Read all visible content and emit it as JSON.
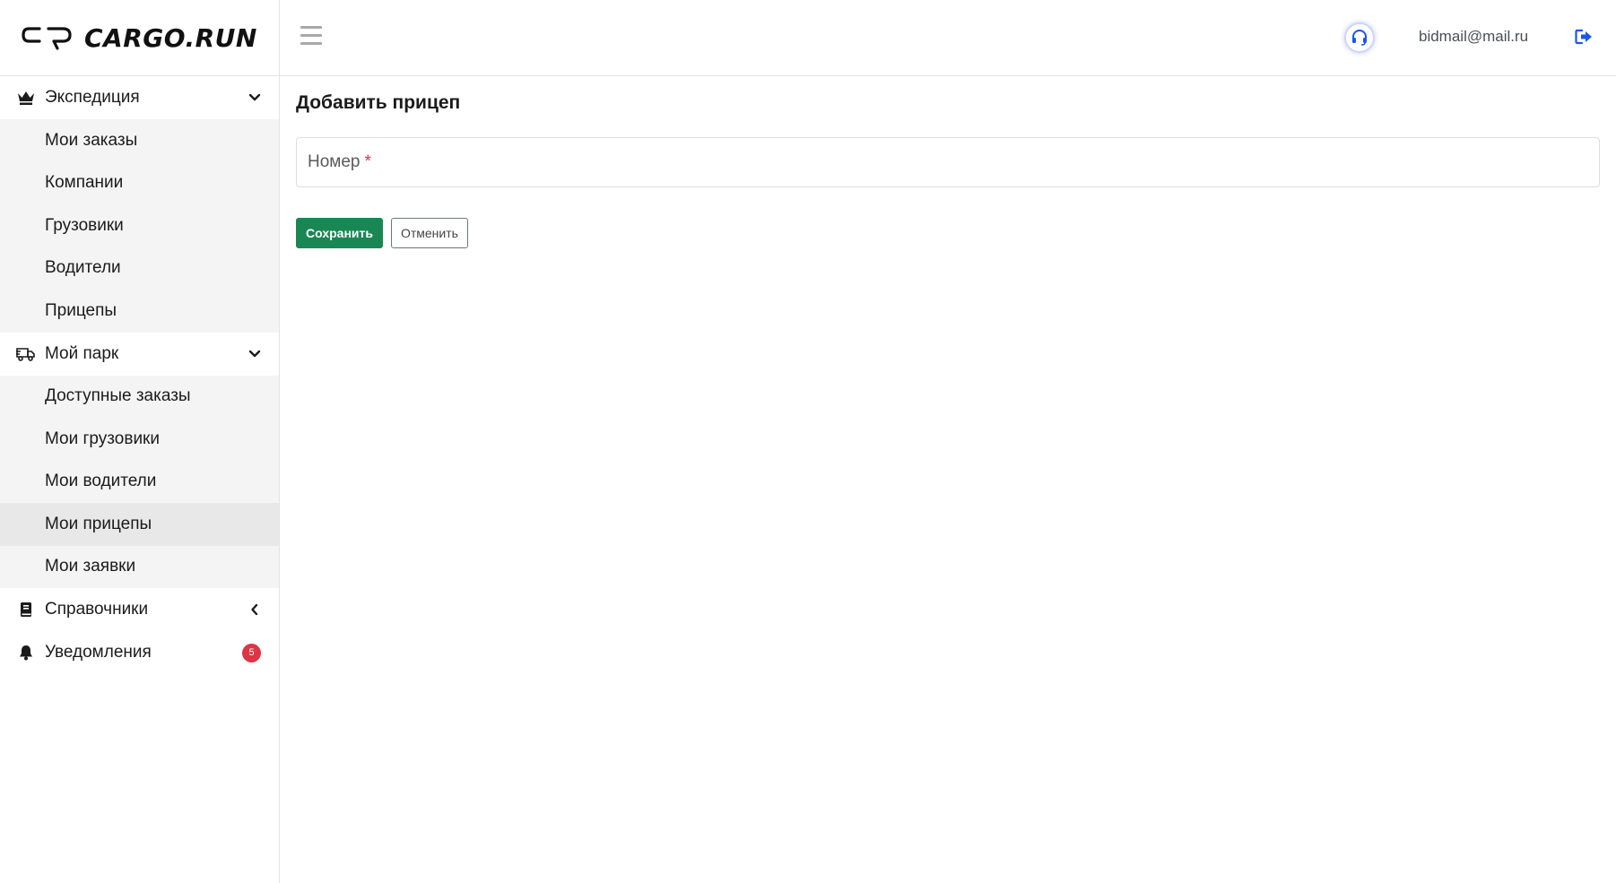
{
  "brand": {
    "name": "CARGO.RUN"
  },
  "header": {
    "user_email": "bidmail@mail.ru",
    "accent_color": "#1a56e8"
  },
  "sidebar": {
    "groups": [
      {
        "label": "Экспедиция",
        "icon": "crown-icon",
        "expanded": true,
        "items": [
          "Мои заказы",
          "Компании",
          "Грузовики",
          "Водители",
          "Прицепы"
        ]
      },
      {
        "label": "Мой парк",
        "icon": "truck-icon",
        "expanded": true,
        "items": [
          "Доступные заказы",
          "Мои грузовики",
          "Мои водители",
          "Мои прицепы",
          "Мои заявки"
        ],
        "active_item": "Мои прицепы"
      },
      {
        "label": "Справочники",
        "icon": "book-icon",
        "expanded": false
      },
      {
        "label": "Уведомления",
        "icon": "bell-icon",
        "badge": "5"
      }
    ]
  },
  "main": {
    "title": "Добавить прицеп",
    "form": {
      "number_label": "Номер",
      "required_mark": "*"
    },
    "actions": {
      "save_label": "Сохранить",
      "cancel_label": "Отменить"
    }
  },
  "colors": {
    "save_button": "#198754",
    "badge": "#dc3545",
    "sidebar_sub_bg": "#f4f4f4",
    "sidebar_active_bg": "#e8e8e8"
  }
}
